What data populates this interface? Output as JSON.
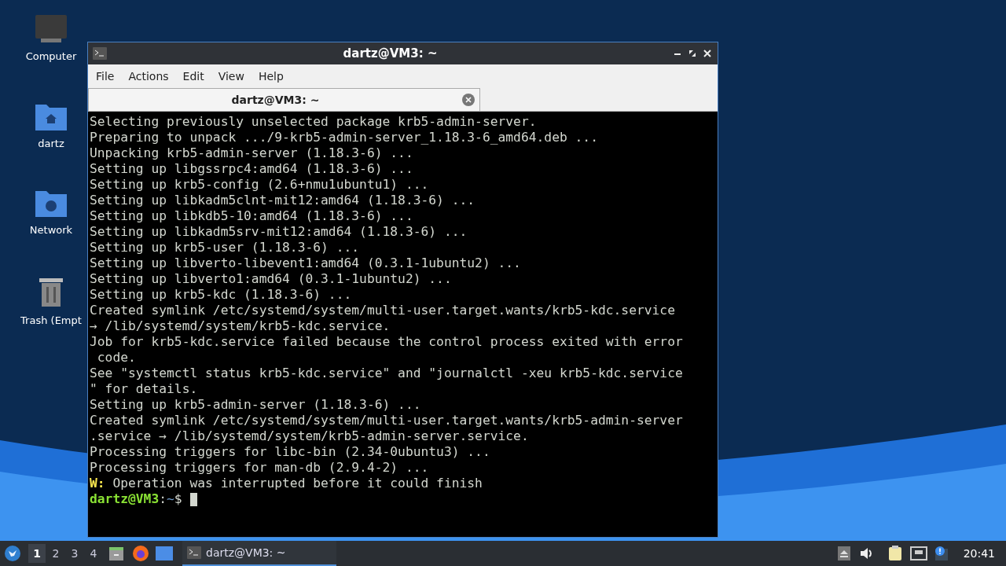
{
  "desktop_icons": [
    {
      "kind": "computer",
      "label": "Computer"
    },
    {
      "kind": "home",
      "label": "dartz"
    },
    {
      "kind": "network",
      "label": "Network"
    },
    {
      "kind": "trash",
      "label": "Trash (Empt"
    }
  ],
  "window": {
    "title": "dartz@VM3: ~",
    "menu": [
      "File",
      "Actions",
      "Edit",
      "View",
      "Help"
    ],
    "tabs": [
      {
        "label": "dartz@VM3: ~",
        "selected": true
      }
    ],
    "lines": [
      {
        "kind": "plain",
        "text": "Selecting previously unselected package krb5-admin-server."
      },
      {
        "kind": "plain",
        "text": "Preparing to unpack .../9-krb5-admin-server_1.18.3-6_amd64.deb ..."
      },
      {
        "kind": "plain",
        "text": "Unpacking krb5-admin-server (1.18.3-6) ..."
      },
      {
        "kind": "plain",
        "text": "Setting up libgssrpc4:amd64 (1.18.3-6) ..."
      },
      {
        "kind": "plain",
        "text": "Setting up krb5-config (2.6+nmu1ubuntu1) ..."
      },
      {
        "kind": "plain",
        "text": "Setting up libkadm5clnt-mit12:amd64 (1.18.3-6) ..."
      },
      {
        "kind": "plain",
        "text": "Setting up libkdb5-10:amd64 (1.18.3-6) ..."
      },
      {
        "kind": "plain",
        "text": "Setting up libkadm5srv-mit12:amd64 (1.18.3-6) ..."
      },
      {
        "kind": "plain",
        "text": "Setting up krb5-user (1.18.3-6) ..."
      },
      {
        "kind": "plain",
        "text": "Setting up libverto-libevent1:amd64 (0.3.1-1ubuntu2) ..."
      },
      {
        "kind": "plain",
        "text": "Setting up libverto1:amd64 (0.3.1-1ubuntu2) ..."
      },
      {
        "kind": "plain",
        "text": "Setting up krb5-kdc (1.18.3-6) ..."
      },
      {
        "kind": "plain",
        "text": "Created symlink /etc/systemd/system/multi-user.target.wants/krb5-kdc.service"
      },
      {
        "kind": "plain",
        "text": "→ /lib/systemd/system/krb5-kdc.service."
      },
      {
        "kind": "plain",
        "text": "Job for krb5-kdc.service failed because the control process exited with error"
      },
      {
        "kind": "plain",
        "text": " code."
      },
      {
        "kind": "plain",
        "text": "See \"systemctl status krb5-kdc.service\" and \"journalctl -xeu krb5-kdc.service"
      },
      {
        "kind": "plain",
        "text": "\" for details."
      },
      {
        "kind": "plain",
        "text": "Setting up krb5-admin-server (1.18.3-6) ..."
      },
      {
        "kind": "plain",
        "text": "Created symlink /etc/systemd/system/multi-user.target.wants/krb5-admin-server"
      },
      {
        "kind": "plain",
        "text": ".service → /lib/systemd/system/krb5-admin-server.service."
      },
      {
        "kind": "plain",
        "text": "Processing triggers for libc-bin (2.34-0ubuntu3) ..."
      },
      {
        "kind": "plain",
        "text": "Processing triggers for man-db (2.9.4-2) ..."
      },
      {
        "kind": "warning",
        "prefix": "W:",
        "text": " Operation was interrupted before it could finish"
      },
      {
        "kind": "prompt",
        "user": "dartz@VM3",
        "sep": ":",
        "path": "~",
        "symbol": "$"
      }
    ]
  },
  "taskbar": {
    "workspaces": [
      {
        "label": "1",
        "selected": true
      },
      {
        "label": "2",
        "selected": false
      },
      {
        "label": "3",
        "selected": false
      },
      {
        "label": "4",
        "selected": false
      }
    ],
    "tasks": [
      {
        "label": "dartz@VM3: ~",
        "selected": true
      }
    ],
    "clock": "20:41"
  }
}
